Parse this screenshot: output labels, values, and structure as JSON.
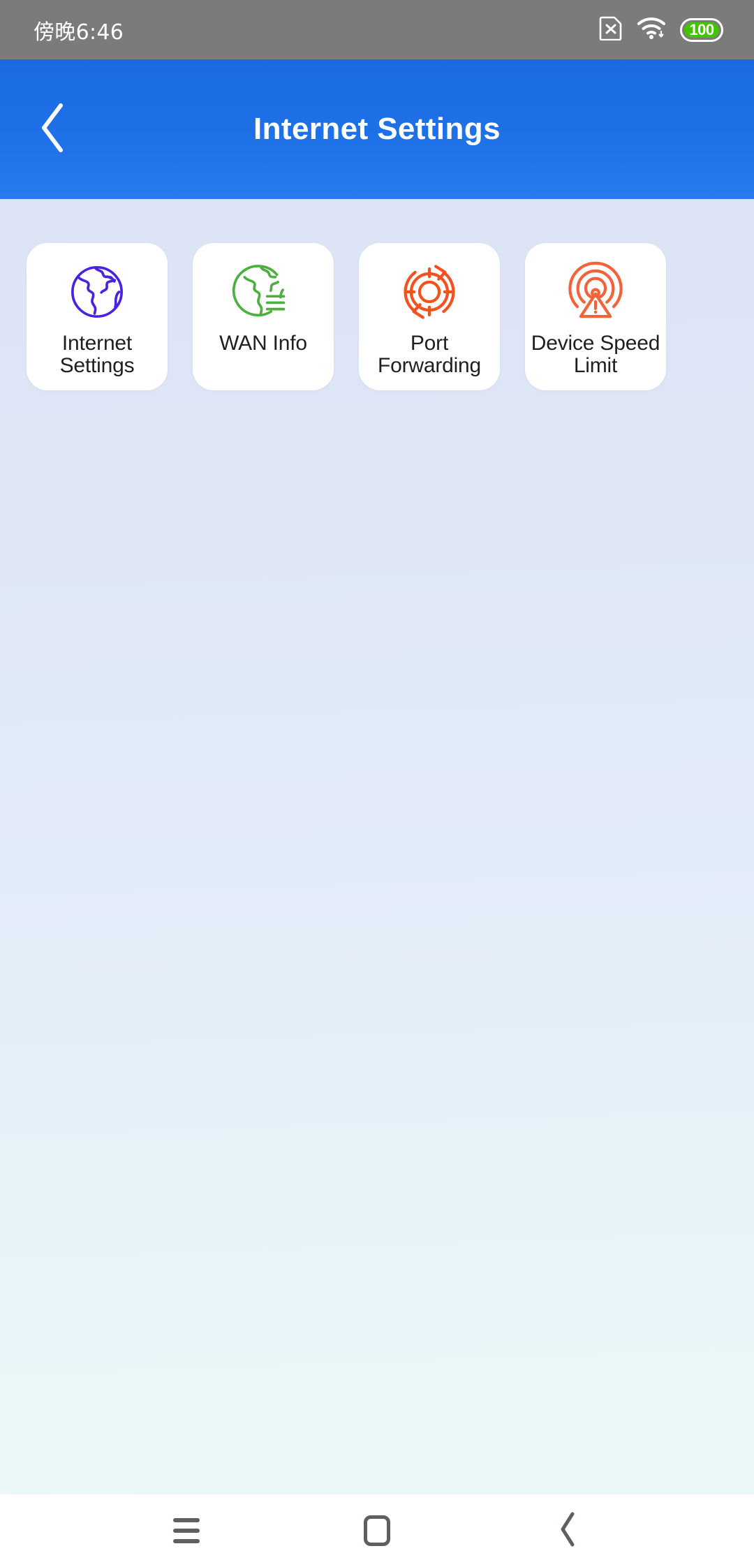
{
  "status_bar": {
    "time": "傍晚6:46",
    "icons": [
      {
        "name": "sim-card-missing-icon",
        "glyph": "sim-x"
      },
      {
        "name": "wifi-icon",
        "glyph": "wifi"
      }
    ],
    "battery": {
      "level": "100",
      "fill_color": "#41c300"
    },
    "background_color": "#7b7b7b",
    "text_color": "#ffffff"
  },
  "header": {
    "title": "Internet Settings",
    "back_icon": "chevron-left-icon",
    "background_color": "#1f71e8",
    "text_color": "#ffffff"
  },
  "content": {
    "background_gradient_from": "#dbe3f5",
    "background_gradient_to": "#ecf7f7",
    "tiles": [
      {
        "id": "internet-settings",
        "label": "Internet\nSettings",
        "icon": "globe-icon",
        "icon_color": "#4a21e0"
      },
      {
        "id": "wan-info",
        "label": "WAN Info",
        "icon": "globe-document-icon",
        "icon_color": "#4caf3f"
      },
      {
        "id": "port-forwarding",
        "label": "Port\nForwarding",
        "icon": "target-refresh-icon",
        "icon_color": "#f4511e"
      },
      {
        "id": "device-speed-limit",
        "label": "Device Speed\nLimit",
        "icon": "broadcast-warning-icon",
        "icon_color": "#f4623a"
      }
    ]
  },
  "nav_bar": {
    "background_color": "#ffffff",
    "icon_color": "#5c5f63",
    "buttons": [
      {
        "id": "recents",
        "icon": "menu-icon"
      },
      {
        "id": "home",
        "icon": "home-square-icon"
      },
      {
        "id": "back",
        "icon": "chevron-left-icon"
      }
    ]
  }
}
